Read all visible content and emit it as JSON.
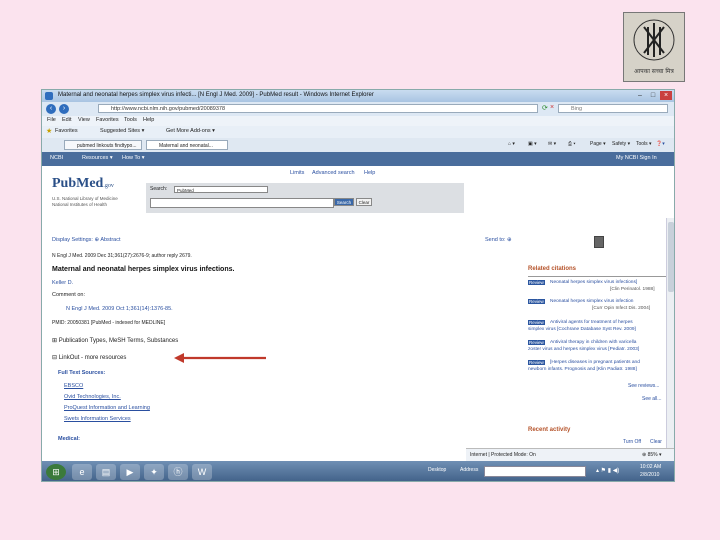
{
  "window": {
    "title": "Maternal and neonatal herpes simplex virus infecti... [N Engl J Med. 2009] - PubMed result - Windows Internet Explorer",
    "controls": [
      "–",
      "□",
      "×"
    ]
  },
  "address": {
    "url": "http://www.ncbi.nlm.nih.gov/pubmed/20089378",
    "search_placeholder": "Bing"
  },
  "menu": [
    "File",
    "Edit",
    "View",
    "Favorites",
    "Tools",
    "Help"
  ],
  "favorites": {
    "label": "Favorites",
    "items": [
      "Suggested Sites ▾",
      "Get More Add-ons ▾"
    ]
  },
  "tabs": [
    "pubmed linkouts findtypo...",
    "Maternal and neonatal..."
  ],
  "commands": [
    "Page ▾",
    "Safety ▾",
    "Tools ▾"
  ],
  "ncbi_bar": {
    "left": "NCBI",
    "resources": "Resources ▾",
    "howto": "How To ▾",
    "account": "My NCBI  Sign In"
  },
  "pubmed": {
    "logo": "PubMed",
    "logo_suffix": ".gov",
    "subtitle": [
      "U.S. National Library of Medicine",
      "National Institutes of Health"
    ],
    "links": [
      "Limits",
      "Advanced search",
      "Help"
    ],
    "search_label": "Search:",
    "db": "PubMed",
    "search_button": "Search",
    "clear_button": "Clear"
  },
  "article": {
    "display_settings": "Display Settings: ⊕ Abstract",
    "send_to": "Send to: ⊕",
    "citation": "N Engl J Med. 2009 Dec 31;361(27):2676-9; author reply 2679.",
    "title": "Maternal and neonatal herpes simplex virus infections.",
    "author": "Keller D.",
    "comment_label": "Comment on:",
    "comment_link": "N Engl J Med. 2009 Oct 1;361(14):1376-85.",
    "pmid": "PMID: 20050381 [PubMed - indexed for MEDLINE]",
    "section1": "Publication Types, MeSH Terms, Substances",
    "section2": "LinkOut - more resources",
    "fulltext_label": "Full Text Sources:",
    "sources": [
      "EBSCO",
      "Ovid Technologies, Inc.",
      "ProQuest Information and Learning",
      "Swets Information Services"
    ],
    "medical_label": "Medical:"
  },
  "related": {
    "heading": "Related citations",
    "items": [
      {
        "badge": "Review",
        "text": "Neonatal herpes simplex virus infections]",
        "ref": "[Clin Perinatol. 1988]"
      },
      {
        "badge": "Review",
        "text": "Neonatal herpes simplex virus infection",
        "ref": "[Curr Opin Infect Dis. 2004]"
      },
      {
        "badge": "Review",
        "text": "Antiviral agents for treatment of herpes",
        "text2": "simplex virus [Cochrane Database Syst Rev. 2009]"
      },
      {
        "badge": "Review",
        "text": "Antiviral therapy in children with varicella",
        "text2": "zoster virus and herpes simplex virus [Pediatr. 2003]"
      },
      {
        "badge": "Review",
        "text": "[Herpes diseases in pregnant patients and",
        "text2": "newborn infants. Prognosis and [Klin Padiatr. 1988]"
      }
    ],
    "see_reviews": "See reviews...",
    "see_all": "See all...",
    "recent_heading": "Recent activity",
    "turn_off": "Turn Off",
    "clear": "Clear"
  },
  "status": {
    "zone": "Internet | Protected Mode: On",
    "zoom": "⊕ 85% ▾"
  },
  "taskbar": {
    "desktop": "Desktop",
    "address": "Address",
    "time": "10:02 AM",
    "date": "2/8/2010"
  },
  "logo_text": "आपका सच्चा मित्र"
}
